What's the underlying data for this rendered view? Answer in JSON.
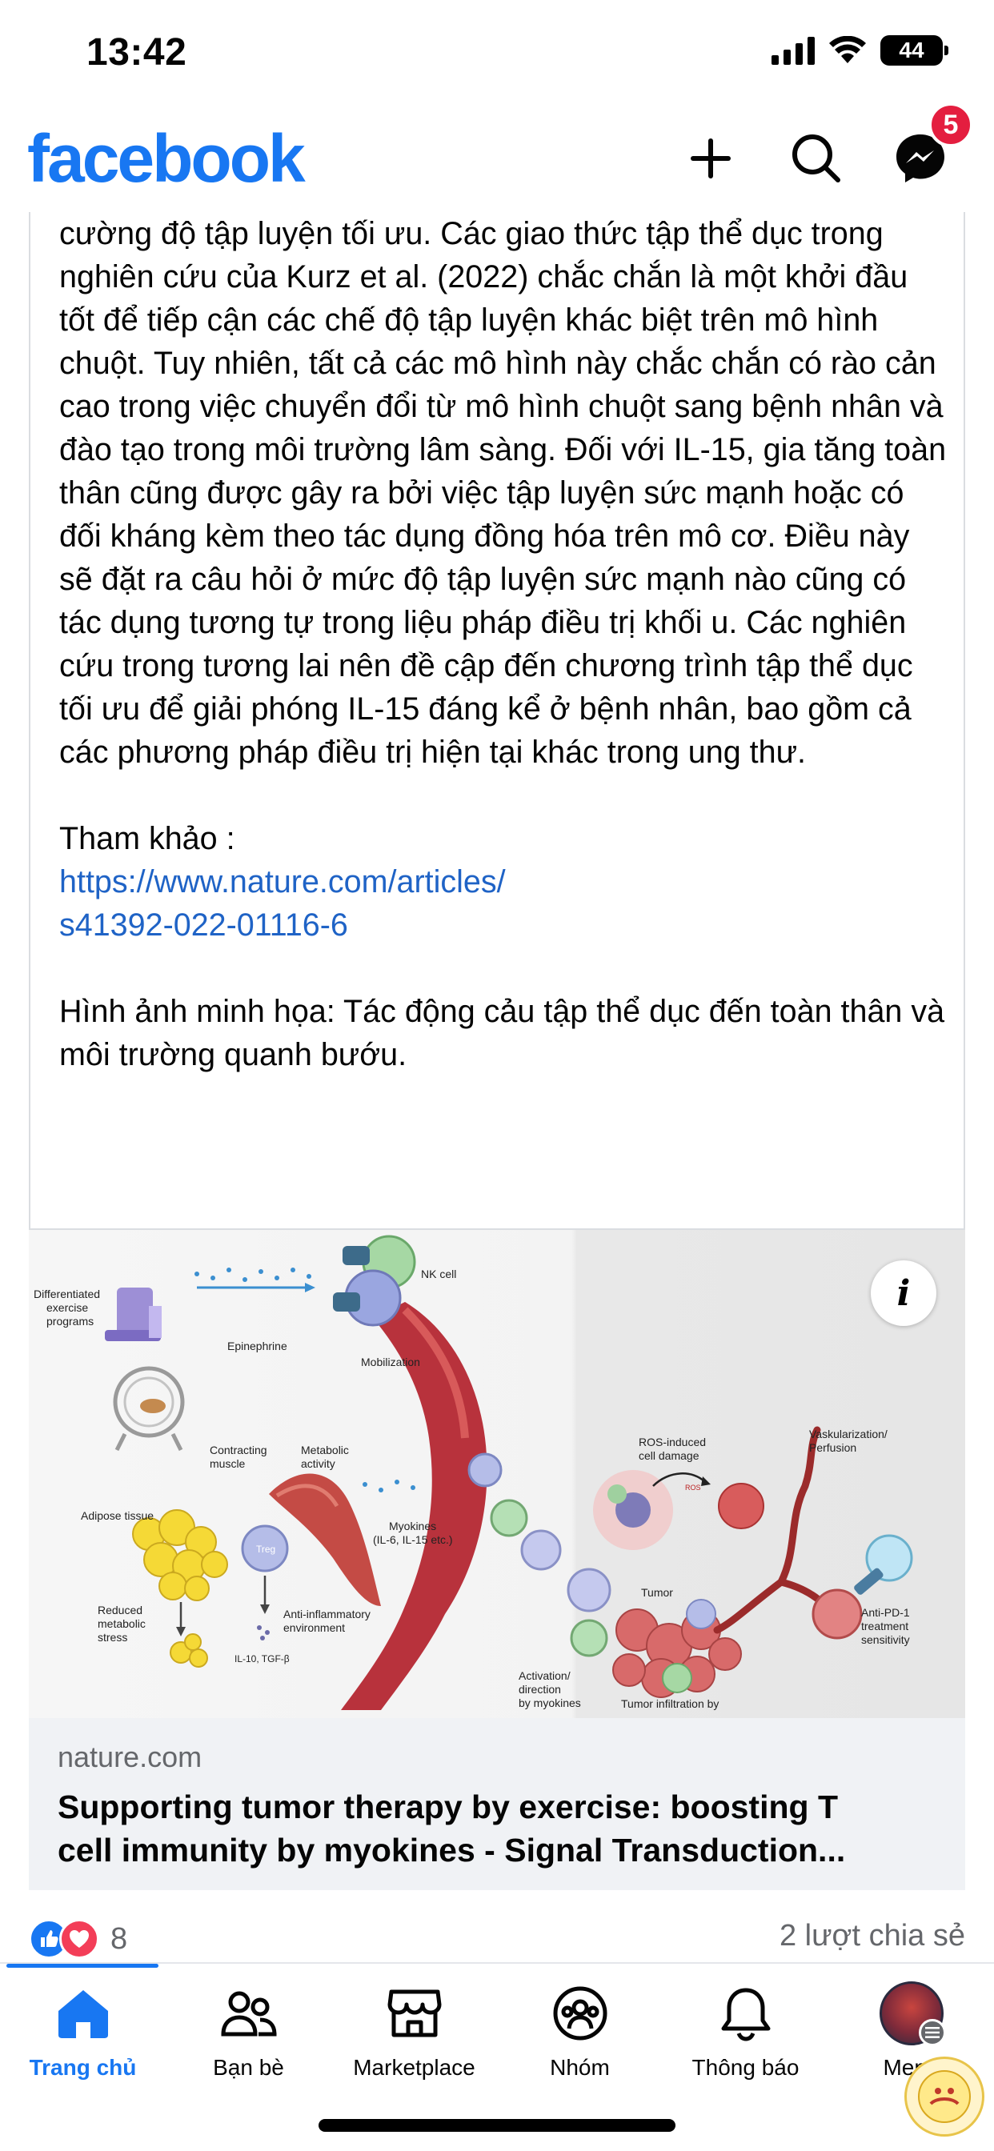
{
  "status_bar": {
    "time": "13:42",
    "battery_level": "44",
    "icons": [
      "cellular-signal-icon",
      "wifi-icon",
      "battery-icon"
    ]
  },
  "header": {
    "logo": "facebook",
    "actions": [
      "plus-icon",
      "search-icon",
      "messenger-icon"
    ],
    "messenger_badge": "5",
    "brand_color": "#1877f2",
    "badge_color": "#e41e3f"
  },
  "post": {
    "body": "cường độ tập luyện tối ưu. Các giao thức tập thể dục trong nghiên cứu của Kurz et al. (2022) chắc chắn là một khởi đầu tốt để tiếp cận các chế độ tập luyện khác biệt trên mô hình chuột. Tuy nhiên, tất cả các mô hình này chắc chắn có rào cản cao trong việc chuyển đổi từ mô hình chuột sang bệnh nhân và đào tạo trong môi trường lâm sàng. Đối với IL-15, gia tăng toàn thân cũng được gây ra bởi việc tập luyện sức mạnh hoặc có đối kháng kèm theo tác dụng đồng hóa trên mô cơ. Điều này sẽ đặt ra câu hỏi ở mức độ tập luyện sức mạnh nào cũng có tác dụng tương tự trong liệu pháp điều trị khối u. Các nghiên cứu trong tương lai nên đề cập đến chương trình tập thể dục tối ưu để giải phóng IL-15 đáng kể ở bệnh nhân, bao gồm cả các phương pháp điều trị hiện tại khác trong ung thư.",
    "reference_label": "Tham khảo :",
    "reference_link_line1": "https://www.nature.com/articles/",
    "reference_link_line2": "s41392-022-01116-6",
    "caption": "Hình ảnh minh họa: Tác động cảu tập thể dục đến toàn thân và môi  trường quanh bướu.",
    "link_color": "#1f63c6"
  },
  "figure": {
    "labels": {
      "nk_cell": "NK cell",
      "differentiated": "Differentiated\nexercise\nprograms",
      "epinephrine": "Epinephrine",
      "mobilization": "Mobilization",
      "contracting_muscle": "Contracting\nmuscle",
      "metabolic_activity": "Metabolic\nactivity",
      "adipose": "Adipose tissue",
      "myokines": "Myokines\n(IL-6, IL-15 etc.)",
      "treg": "Treg",
      "reduced_stress": "Reduced\nmetabolic\nstress",
      "anti_inflammatory": "Anti-inflammatory\nenvironment",
      "il10": "IL-10, TGF-β",
      "ros": "ROS-induced\ncell damage",
      "ros_small": "ROS",
      "vascular": "Vaskularization/\nPerfusion",
      "tumor": "Tumor",
      "anti_pd1": "Anti-PD-1\ntreatment\nsensitivity",
      "activation": "Activation/\ndirection\nby myokines",
      "infiltration": "Tumor infiltration by"
    }
  },
  "link_preview": {
    "domain": "nature.com",
    "title_line1": "Supporting tumor therapy by exercise: boosting T",
    "title_line2": "cell immunity by myokines - Signal Transduction..."
  },
  "engagement": {
    "reaction_icons": [
      "like-icon",
      "love-icon"
    ],
    "reaction_count": "8",
    "shares": "2 lượt chia sẻ"
  },
  "tabbar": {
    "tabs": [
      {
        "label": "Trang chủ",
        "icon": "home-icon",
        "active": true
      },
      {
        "label": "Bạn bè",
        "icon": "friends-icon",
        "active": false
      },
      {
        "label": "Marketplace",
        "icon": "marketplace-icon",
        "active": false
      },
      {
        "label": "Nhóm",
        "icon": "groups-icon",
        "active": false
      },
      {
        "label": "Thông báo",
        "icon": "bell-icon",
        "active": false
      },
      {
        "label": "Menu",
        "icon": "avatar",
        "active": false
      }
    ]
  }
}
